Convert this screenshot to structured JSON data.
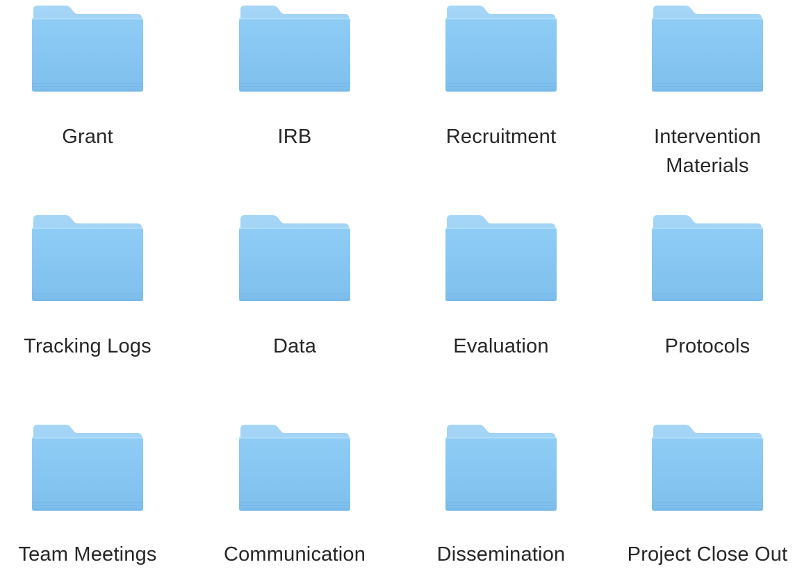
{
  "folders": [
    {
      "label": "Grant"
    },
    {
      "label": "IRB"
    },
    {
      "label": "Recruitment"
    },
    {
      "label": "Intervention\nMaterials"
    },
    {
      "label": "Tracking Logs"
    },
    {
      "label": "Data"
    },
    {
      "label": "Evaluation"
    },
    {
      "label": "Protocols"
    },
    {
      "label": "Team Meetings"
    },
    {
      "label": "Communication"
    },
    {
      "label": "Dissemination"
    },
    {
      "label": "Project Close Out"
    }
  ],
  "icon": "folder-icon",
  "colors": {
    "folder_back": "#8dc8ef",
    "folder_front_top": "#8fcdf6",
    "folder_front_bottom": "#7ebfed",
    "label_text": "#262626"
  }
}
